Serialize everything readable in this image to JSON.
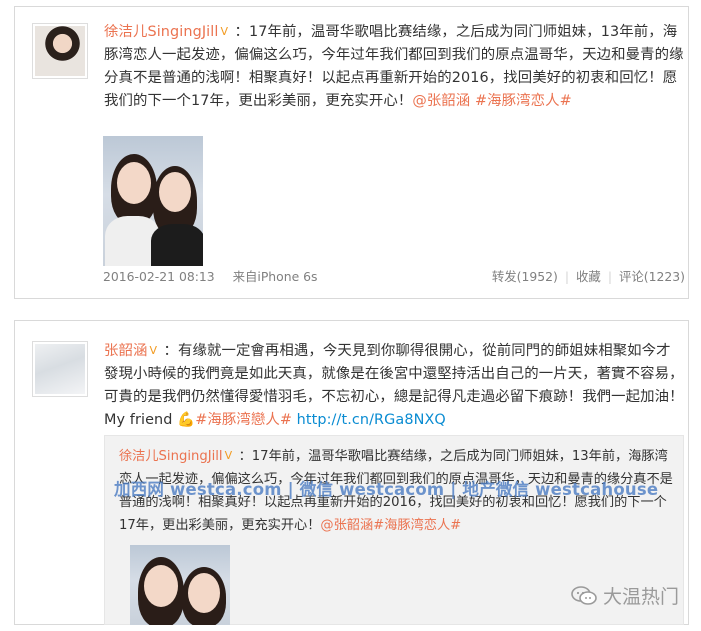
{
  "post1": {
    "author": "徐洁儿SingingJill",
    "verified_badge": "V",
    "text_part1": "：17年前，温哥华歌唱比赛结缘，之后成为同门师姐妹，13年前，海豚湾恋人一起发迹，偏偏这么巧，今年过年我们都回到我们的原点温哥华，天边和曼青的缘分真不是普通的浅啊！相聚真好！以起点再重新开始的2016，找回美好的初衷和回忆！愿我们的下一个17年，更出彩美丽，更充实开心！",
    "mention": "@张韶涵",
    "hashtag": "#海豚湾恋人#",
    "timestamp": "2016-02-21 08:13",
    "source": "来自iPhone 6s",
    "repost": "转发(1952)",
    "favorite": "收藏",
    "comment": "评论(1223)"
  },
  "post2": {
    "author": "张韶涵",
    "verified_badge": "V",
    "text": "：有缘就一定會再相遇，今天見到你聊得很開心，從前同門的師姐妹相聚如今才發現小時候的我們竟是如此天真，就像是在後宮中還堅持活出自己的一片天，著實不容易，可貴的是我們仍然懂得愛惜羽毛，不忘初心，總是記得凡走過必留下痕跡！我們一起加油！ My friend ",
    "emoji": "💪",
    "hashtag": "#海豚湾戀人#",
    "link": "http://t.cn/RGa8NXQ",
    "quoted": {
      "author": "徐洁儿SingingJill",
      "text": "：17年前，温哥华歌唱比赛结缘，之后成为同门师姐妹，13年前，海豚湾恋人一起发迹，偏偏这么巧，今年过年我们都回到我们的原点温哥华，天边和曼青的缘分真不是普通的浅啊！相聚真好！以起点再重新开始的2016，找回美好的初衷和回忆！愿我们的下一个17年，更出彩美丽，更充实开心！",
      "mention": "@张韶涵",
      "hashtag": "#海豚湾恋人#"
    }
  },
  "watermark": "加西网 westca.com | 微信 westcacom | 地产微信 westcahouse",
  "brand": "大温热门",
  "colors": {
    "name": "#eb7350",
    "link": "#0a8cd2",
    "meta": "#808080"
  }
}
